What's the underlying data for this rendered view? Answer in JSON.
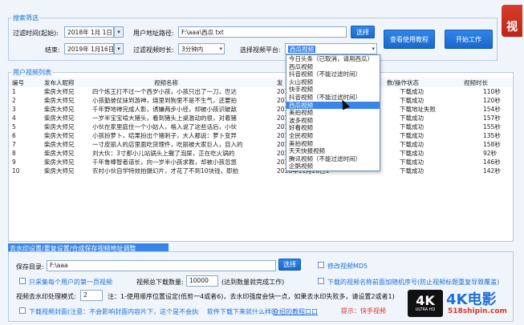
{
  "filter": {
    "legend": "搜索筛选",
    "date_start_label": "过滤时间(起始):",
    "date_start": "2018年 1月 1日",
    "date_end_label": "结束:",
    "date_end": "2019年 1月16日",
    "user_path_label": "用户地址路径:",
    "user_path": "F:\\aaa\\西瓜 txt",
    "browse_btn": "选择",
    "duration_label": "过滤视频时长:",
    "duration_value": "3分钟内",
    "platform_label": "选择视频平台:",
    "platform_value": "西瓜视频",
    "help_btn": "查看使用教程",
    "start_btn": "开始工作"
  },
  "list": {
    "legend": "用户视频列表",
    "columns": [
      "编号",
      "发布人昵称",
      "视频名称",
      "发",
      "数/操作状态",
      "视频时长"
    ],
    "rows": [
      {
        "id": "1",
        "author": "柴房大师兄",
        "title": "四个炼王打不过一个西岁小孩，小孩只出了一刀，世达",
        "date": "2019",
        "status": "下载成功",
        "len": "110秒"
      },
      {
        "id": "2",
        "author": "柴房大师兄",
        "title": "小孩勤彼仗抹到游神，烧里到狗里不是不生气，还要拍",
        "date": "2018",
        "status": "下载成功",
        "len": "120秒"
      },
      {
        "id": "3",
        "author": "柴房大师兄",
        "title": "千年野地禅完成人影，诱嫌两步小径，却被小孩识破敌",
        "date": "2018",
        "status": "下载地址失败",
        "len": "154秒"
      },
      {
        "id": "4",
        "author": "柴房大师兄",
        "title": "一岁半宝宝啃大猪头，看到猪头上桌激动的很，对着猪",
        "date": "2018",
        "status": "下载成功",
        "len": "157秒"
      },
      {
        "id": "5",
        "author": "柴房大师兄",
        "title": "小伙在家里庭住一个小姑人，格入说了这些话后，小伙",
        "date": "2018",
        "status": "下载成功",
        "len": "155秒"
      },
      {
        "id": "6",
        "author": "柴房大师兄",
        "title": "小孩扮萝卜，结果扮出个猪刺子，大人都说：萝卜变异",
        "date": "2018",
        "status": "下载成功",
        "len": "135秒"
      },
      {
        "id": "7",
        "author": "柴房大师兄",
        "title": "一寸皮丽人的店里面吃货理件，吃丽被大家巨人，目入的",
        "date": "2018",
        "status": "下载成功",
        "len": "158秒"
      },
      {
        "id": "8",
        "author": "柴房大师兄",
        "title": "刘大伙：3寸那小儿站锅头上撒了泡尿，正在吃火锅的",
        "date": "2018",
        "status": "下载成功",
        "len": "92秒"
      },
      {
        "id": "9",
        "author": "柴房大师兄",
        "title": "千年鲁棒智者道长，向一岁半小孩求教，却被小孩忽悠",
        "date": "2018年11月30日",
        "status": "下载成功",
        "len": "146秒"
      },
      {
        "id": "10",
        "author": "柴房大师兄",
        "title": "农村小伙自学特效拍摄幻片，才花了不到10块钱，即拍",
        "date": "2018年11月28日1",
        "status": "下载成功",
        "len": "142秒"
      }
    ]
  },
  "dropdown": {
    "header": "西瓜视频",
    "options": [
      "今日头条（已取消，请用西瓜）",
      "西瓜视频",
      "抖音视频（不能过滤时间）",
      "火山视频",
      "快手视频",
      "抖音视频（不能过滤时间）",
      "西瓜视频",
      "美拍视频",
      "波多视频",
      "好看视频",
      "全民视频",
      "美拍视频",
      "天天快报视频",
      "腾讯视频（不能过滤时间）",
      "企鹅视频"
    ],
    "selected_index": 6
  },
  "save": {
    "legend": "去水印设置/重复设置/合成保存视频地址调整",
    "dir_label": "保存目录:",
    "dir_value": "F:\\aaa",
    "browse_btn": "选择",
    "md5_label": "修改视频MD5",
    "only_first_label": "只采集每个用户的第一页视频",
    "limit_label": "视频总下载数量:",
    "limit_value": "10000",
    "limit_note": "(达到数量就完成工作)",
    "sort_label": "下载的视频名称前面加随机序号(防止视频标题重复导致覆盖)",
    "watermark_label": "视频去水印处理模式:",
    "watermark_value": "2",
    "watermark_note": "注：1-使用顺序位置设定(低剪一4或者6)，去水印强度会快一点，如果去水印失败多，请设置2或者1)",
    "cover_label": "下载视频封面(注意：不会影响封面内容片下，这个是不会执行的)",
    "cover_note": "软件下载下来就什么样的",
    "intro_link": "介绍的教程口口",
    "tip": "提示：快手视频"
  },
  "brand": {
    "logo_text": "4K",
    "logo_sub": "ULTRA HD",
    "name": "4K电影",
    "url": "518shipin.com",
    "corner_text": "视"
  },
  "colors": {
    "accent": "#1e6fd9",
    "button": "#1b68cc",
    "selection": "#3a86e8"
  }
}
